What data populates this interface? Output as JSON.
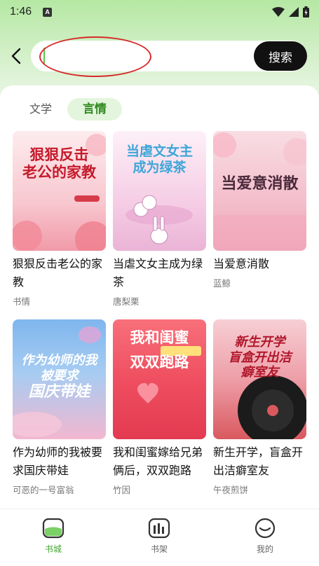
{
  "status_bar": {
    "time": "1:46",
    "notification_badge": "A"
  },
  "search": {
    "value": "",
    "placeholder": "",
    "button_label": "搜索"
  },
  "tabs": [
    {
      "label": "文学",
      "active": false
    },
    {
      "label": "言情",
      "active": true
    }
  ],
  "books": [
    {
      "title": "狠狠反击老公的家教",
      "author": "书情",
      "cover_text": "狠狠反击\n老公的家教",
      "cover_colors": [
        "#fde3e5",
        "#f6a9b5"
      ],
      "cover_text_color": "#c51a2b"
    },
    {
      "title": "当虐文女主成为绿茶",
      "author": "唐梨栗",
      "cover_text": "当虐文女主\n成为绿茶",
      "cover_colors": [
        "#fbe4f2",
        "#e9b3d9"
      ],
      "cover_text_color": "#3ea6d8"
    },
    {
      "title": "当爱意消散",
      "author": "蓝鲸",
      "cover_text": "当爱意消散",
      "cover_colors": [
        "#f7d6df",
        "#f1b2c2"
      ],
      "cover_text_color": "#4a2a3a"
    },
    {
      "title": "作为幼师的我被要求国庆带娃",
      "author": "可恶的一号富翁",
      "cover_text": "作为幼师的我\n被要求\n国庆带娃",
      "cover_colors": [
        "#8ec3f1",
        "#f4b6d1"
      ],
      "cover_text_color": "#ffffff"
    },
    {
      "title": "我和闺蜜嫁给兄弟俩后，双双跑路",
      "author": "竹因",
      "cover_text": "我和闺蜜\n双双跑路",
      "cover_colors": [
        "#f45f6a",
        "#e83a4f"
      ],
      "cover_text_color": "#ffffff"
    },
    {
      "title": "新生开学，盲盒开出洁癖室友",
      "author": "午夜煎饼",
      "cover_text": "新生开学\n盲盒开出洁\n癖室友",
      "cover_colors": [
        "#f4c3c9",
        "#d9595f"
      ],
      "cover_text_color": "#b0162a"
    }
  ],
  "bottom_nav": [
    {
      "label": "书城",
      "icon": "bookstore-icon",
      "active": true
    },
    {
      "label": "书架",
      "icon": "bookshelf-icon",
      "active": false
    },
    {
      "label": "我的",
      "icon": "profile-icon",
      "active": false
    }
  ],
  "colors": {
    "accent": "#45a832",
    "search_button": "#111111",
    "annotation_ellipse": "#d62a2a"
  }
}
